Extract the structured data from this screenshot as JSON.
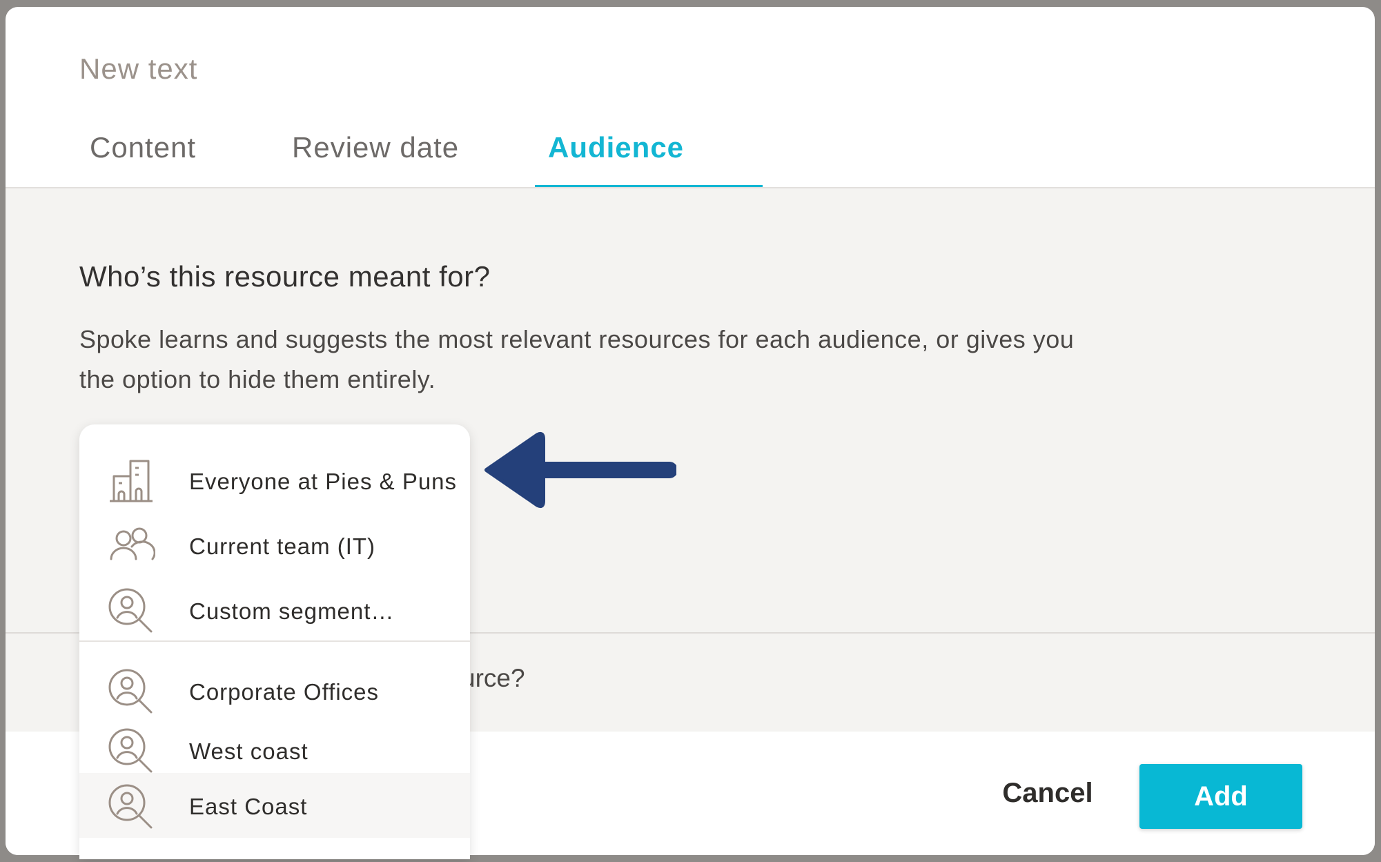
{
  "modal": {
    "title": "New text"
  },
  "tabs": [
    {
      "label": "Content",
      "active": false
    },
    {
      "label": "Review date",
      "active": false
    },
    {
      "label": "Audience",
      "active": true
    }
  ],
  "audience": {
    "question": "Who’s this resource meant for?",
    "description": "Spoke learns and suggests the most relevant resources for each audience, or gives you the option to hide them entirely.",
    "second_question_partial": "urce?"
  },
  "dropdown": {
    "items": [
      {
        "label": "Everyone at Pies & Puns",
        "icon": "building-icon"
      },
      {
        "label": "Current team (IT)",
        "icon": "team-icon"
      },
      {
        "label": "Custom segment…",
        "icon": "user-search-icon"
      },
      {
        "label": "Corporate Offices",
        "icon": "user-search-icon"
      },
      {
        "label": "West coast",
        "icon": "user-search-icon"
      },
      {
        "label": "East Coast",
        "icon": "user-search-icon",
        "highlighted": true
      }
    ]
  },
  "footer": {
    "cancel_label": "Cancel",
    "add_label": "Add"
  },
  "colors": {
    "accent": "#13b6d3",
    "button": "#08b8d4",
    "arrow": "#24407a",
    "icon": "#9b8f86"
  }
}
